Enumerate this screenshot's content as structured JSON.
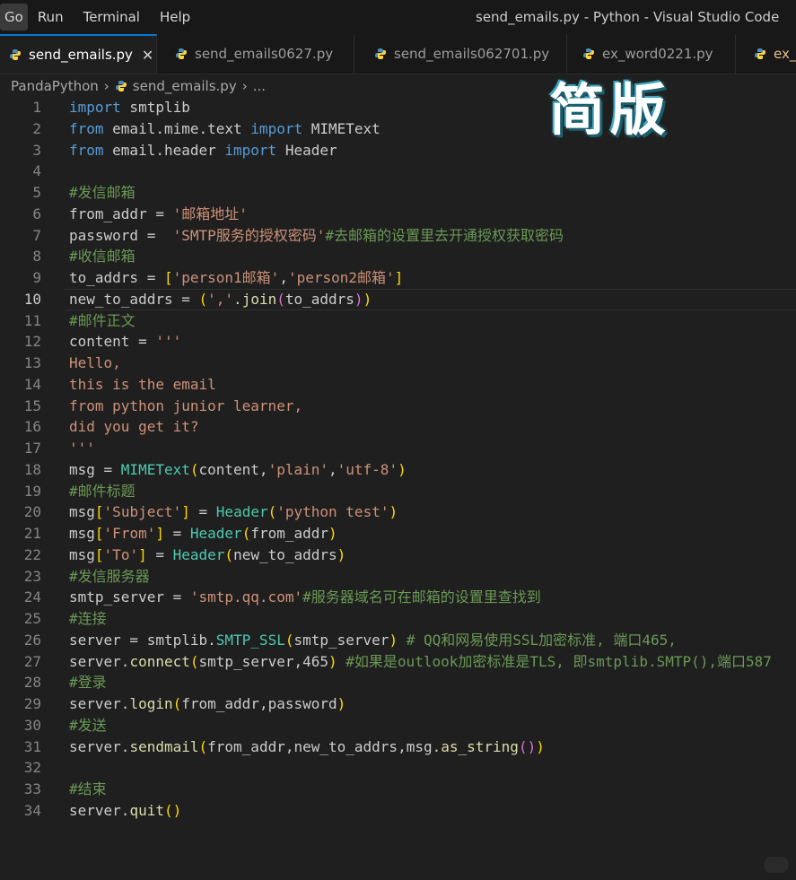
{
  "menu": {
    "items": [
      "Go",
      "Run",
      "Terminal",
      "Help"
    ]
  },
  "window_title": "send_emails.py - Python - Visual Studio Code",
  "tabs": [
    {
      "label": "send_emails.py",
      "active": true
    },
    {
      "label": "send_emails0627.py",
      "active": false
    },
    {
      "label": "send_emails062701.py",
      "active": false
    },
    {
      "label": "ex_word0221.py",
      "active": false
    },
    {
      "label": "ex_p",
      "active": false
    }
  ],
  "breadcrumb": {
    "folder": "PandaPython",
    "file": "send_emails.py",
    "more": "..."
  },
  "overlay_title": "简版",
  "current_line": 10,
  "code_lines": [
    {
      "n": "1",
      "tokens": [
        {
          "t": "import",
          "c": "kw"
        },
        {
          "t": " smtplib"
        }
      ]
    },
    {
      "n": "2",
      "tokens": [
        {
          "t": "from",
          "c": "kw"
        },
        {
          "t": " email.mime.text "
        },
        {
          "t": "import",
          "c": "kw"
        },
        {
          "t": " MIMEText"
        }
      ]
    },
    {
      "n": "3",
      "tokens": [
        {
          "t": "from",
          "c": "kw"
        },
        {
          "t": " email.header "
        },
        {
          "t": "import",
          "c": "kw"
        },
        {
          "t": " Header"
        }
      ]
    },
    {
      "n": "4",
      "tokens": []
    },
    {
      "n": "5",
      "tokens": [
        {
          "t": "#发信邮箱",
          "c": "cmt"
        }
      ]
    },
    {
      "n": "6",
      "tokens": [
        {
          "t": "from_addr = "
        },
        {
          "t": "'邮箱地址'",
          "c": "str"
        }
      ]
    },
    {
      "n": "7",
      "tokens": [
        {
          "t": "password =  "
        },
        {
          "t": "'SMTP服务的授权密码'",
          "c": "str"
        },
        {
          "t": "#去邮箱的设置里去开通授权获取密码",
          "c": "cmt"
        }
      ]
    },
    {
      "n": "8",
      "tokens": [
        {
          "t": "#收信邮箱",
          "c": "cmt"
        }
      ]
    },
    {
      "n": "9",
      "tokens": [
        {
          "t": "to_addrs = "
        },
        {
          "t": "[",
          "c": "brk1"
        },
        {
          "t": "'person1邮箱'",
          "c": "str"
        },
        {
          "t": ","
        },
        {
          "t": "'person2邮箱'",
          "c": "str"
        },
        {
          "t": "]",
          "c": "brk1"
        }
      ]
    },
    {
      "n": "10",
      "tokens": [
        {
          "t": "new_to_addrs = "
        },
        {
          "t": "(",
          "c": "brk1"
        },
        {
          "t": "','",
          "c": "str"
        },
        {
          "t": "."
        },
        {
          "t": "join",
          "c": "fn"
        },
        {
          "t": "(",
          "c": "brk2"
        },
        {
          "t": "to_addrs"
        },
        {
          "t": ")",
          "c": "brk2"
        },
        {
          "t": ")",
          "c": "brk1"
        }
      ]
    },
    {
      "n": "11",
      "tokens": [
        {
          "t": "#邮件正文",
          "c": "cmt"
        }
      ]
    },
    {
      "n": "12",
      "tokens": [
        {
          "t": "content = "
        },
        {
          "t": "'''",
          "c": "str"
        }
      ]
    },
    {
      "n": "13",
      "tokens": [
        {
          "t": "Hello,",
          "c": "str"
        }
      ]
    },
    {
      "n": "14",
      "tokens": [
        {
          "t": "this is the email",
          "c": "str"
        }
      ]
    },
    {
      "n": "15",
      "tokens": [
        {
          "t": "from python junior learner,",
          "c": "str"
        }
      ]
    },
    {
      "n": "16",
      "tokens": [
        {
          "t": "did you get it?",
          "c": "str"
        }
      ]
    },
    {
      "n": "17",
      "tokens": [
        {
          "t": "'''",
          "c": "str"
        }
      ]
    },
    {
      "n": "18",
      "tokens": [
        {
          "t": "msg = "
        },
        {
          "t": "MIMEText",
          "c": "cls"
        },
        {
          "t": "(",
          "c": "brk1"
        },
        {
          "t": "content,"
        },
        {
          "t": "'plain'",
          "c": "str"
        },
        {
          "t": ","
        },
        {
          "t": "'utf-8'",
          "c": "str"
        },
        {
          "t": ")",
          "c": "brk1"
        }
      ]
    },
    {
      "n": "19",
      "tokens": [
        {
          "t": "#邮件标题",
          "c": "cmt"
        }
      ]
    },
    {
      "n": "20",
      "tokens": [
        {
          "t": "msg"
        },
        {
          "t": "[",
          "c": "brk1"
        },
        {
          "t": "'Subject'",
          "c": "str"
        },
        {
          "t": "]",
          "c": "brk1"
        },
        {
          "t": " = "
        },
        {
          "t": "Header",
          "c": "cls"
        },
        {
          "t": "(",
          "c": "brk1"
        },
        {
          "t": "'python test'",
          "c": "str"
        },
        {
          "t": ")",
          "c": "brk1"
        }
      ]
    },
    {
      "n": "21",
      "tokens": [
        {
          "t": "msg"
        },
        {
          "t": "[",
          "c": "brk1"
        },
        {
          "t": "'From'",
          "c": "str"
        },
        {
          "t": "]",
          "c": "brk1"
        },
        {
          "t": " = "
        },
        {
          "t": "Header",
          "c": "cls"
        },
        {
          "t": "(",
          "c": "brk1"
        },
        {
          "t": "from_addr"
        },
        {
          "t": ")",
          "c": "brk1"
        }
      ]
    },
    {
      "n": "22",
      "tokens": [
        {
          "t": "msg"
        },
        {
          "t": "[",
          "c": "brk1"
        },
        {
          "t": "'To'",
          "c": "str"
        },
        {
          "t": "]",
          "c": "brk1"
        },
        {
          "t": " = "
        },
        {
          "t": "Header",
          "c": "cls"
        },
        {
          "t": "(",
          "c": "brk1"
        },
        {
          "t": "new_to_addrs"
        },
        {
          "t": ")",
          "c": "brk1"
        }
      ]
    },
    {
      "n": "23",
      "tokens": [
        {
          "t": "#发信服务器",
          "c": "cmt"
        }
      ]
    },
    {
      "n": "24",
      "tokens": [
        {
          "t": "smtp_server = "
        },
        {
          "t": "'smtp.qq.com'",
          "c": "str"
        },
        {
          "t": "#服务器域名可在邮箱的设置里查找到",
          "c": "cmt"
        }
      ]
    },
    {
      "n": "25",
      "tokens": [
        {
          "t": "#连接",
          "c": "cmt"
        }
      ]
    },
    {
      "n": "26",
      "tokens": [
        {
          "t": "server = smtplib."
        },
        {
          "t": "SMTP_SSL",
          "c": "cls"
        },
        {
          "t": "(",
          "c": "brk1"
        },
        {
          "t": "smtp_server"
        },
        {
          "t": ")",
          "c": "brk1"
        },
        {
          "t": " # QQ和网易使用SSL加密标准, 端口465,",
          "c": "cmt"
        }
      ]
    },
    {
      "n": "27",
      "tokens": [
        {
          "t": "server."
        },
        {
          "t": "connect",
          "c": "fn"
        },
        {
          "t": "(",
          "c": "brk1"
        },
        {
          "t": "smtp_server,465"
        },
        {
          "t": ")",
          "c": "brk1"
        },
        {
          "t": " #如果是outlook加密标准是TLS, 即smtplib.SMTP(),端口587",
          "c": "cmt"
        }
      ]
    },
    {
      "n": "28",
      "tokens": [
        {
          "t": "#登录",
          "c": "cmt"
        }
      ]
    },
    {
      "n": "29",
      "tokens": [
        {
          "t": "server."
        },
        {
          "t": "login",
          "c": "fn"
        },
        {
          "t": "(",
          "c": "brk1"
        },
        {
          "t": "from_addr,password"
        },
        {
          "t": ")",
          "c": "brk1"
        }
      ]
    },
    {
      "n": "30",
      "tokens": [
        {
          "t": "#发送",
          "c": "cmt"
        }
      ]
    },
    {
      "n": "31",
      "tokens": [
        {
          "t": "server."
        },
        {
          "t": "sendmail",
          "c": "fn"
        },
        {
          "t": "(",
          "c": "brk1"
        },
        {
          "t": "from_addr,new_to_addrs,msg."
        },
        {
          "t": "as_string",
          "c": "fn"
        },
        {
          "t": "()",
          "c": "brk2"
        },
        {
          "t": ")",
          "c": "brk1"
        }
      ]
    },
    {
      "n": "32",
      "tokens": []
    },
    {
      "n": "33",
      "tokens": [
        {
          "t": "#结束",
          "c": "cmt"
        }
      ]
    },
    {
      "n": "34",
      "tokens": [
        {
          "t": "server."
        },
        {
          "t": "quit",
          "c": "fn"
        },
        {
          "t": "()",
          "c": "brk1"
        }
      ]
    }
  ],
  "colors": {
    "background": "#1f1f1f",
    "keyword": "#569cd6",
    "string": "#ce9178",
    "comment": "#6a9955",
    "function": "#dcdcaa",
    "class": "#4ec9b0",
    "accent": "#0078d4"
  }
}
